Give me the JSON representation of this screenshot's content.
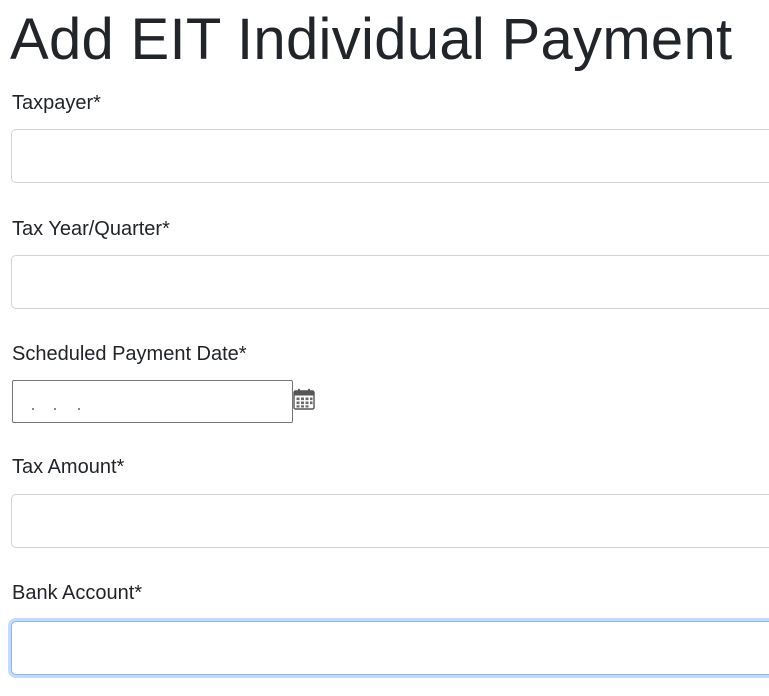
{
  "page": {
    "title": "Add EIT Individual Payment"
  },
  "form": {
    "taxpayer": {
      "label": "Taxpayer*",
      "value": ""
    },
    "tax_year_quarter": {
      "label": "Tax Year/Quarter*",
      "value": ""
    },
    "scheduled_payment_date": {
      "label": "Scheduled Payment Date*",
      "value": "",
      "icon": "calendar-icon"
    },
    "tax_amount": {
      "label": "Tax Amount*",
      "value": ""
    },
    "bank_account": {
      "label": "Bank Account*",
      "value": "",
      "state": "focused"
    }
  },
  "colors": {
    "text": "#212529",
    "input_border": "#ced4da",
    "focus_border": "#86b7fe",
    "date_border": "#767676"
  }
}
